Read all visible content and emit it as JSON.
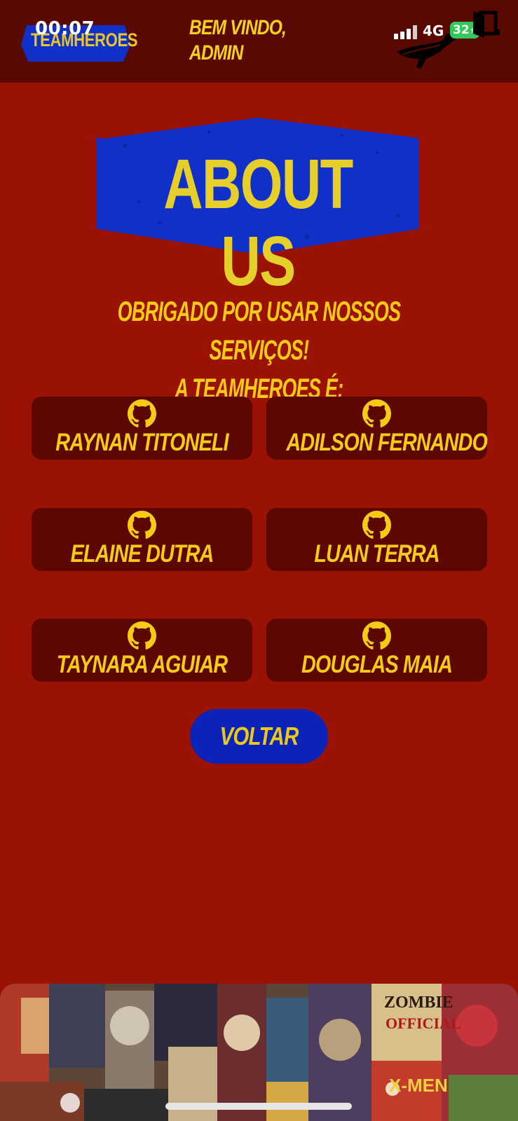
{
  "status_bar": {
    "time": "00:07",
    "network": "4G",
    "battery": "32"
  },
  "header": {
    "logo_text": "TEAMHEROES",
    "welcome_line1": "BEM VINDO,",
    "welcome_line2": "ADMIN"
  },
  "about": {
    "banner_text": "ABOUT US",
    "intro_line1": "OBRIGADO POR USAR NOSSOS SERVIÇOS!",
    "intro_line2": "A TEAMHEROES É:"
  },
  "members": [
    {
      "name": "RAYNAN TITONELI",
      "icon": "github-icon"
    },
    {
      "name": "ADILSON FERNANDO",
      "icon": "github-icon"
    },
    {
      "name": "ELAINE DUTRA",
      "icon": "github-icon"
    },
    {
      "name": "LUAN TERRA",
      "icon": "github-icon"
    },
    {
      "name": "TAYNARA AGUIAR",
      "icon": "github-icon"
    },
    {
      "name": "DOUGLAS MAIA",
      "icon": "github-icon"
    }
  ],
  "actions": {
    "back_label": "VOLTAR"
  },
  "colors": {
    "background": "#9a1203",
    "header": "#5a0900",
    "card": "#5c0700",
    "accent_yellow": "#f5cb16",
    "accent_blue": "#0b23b8"
  },
  "footer": {
    "collage_text_1": "ZOMBIE",
    "collage_text_2": "OFFICIAL",
    "collage_text_3": "X-MEN"
  }
}
